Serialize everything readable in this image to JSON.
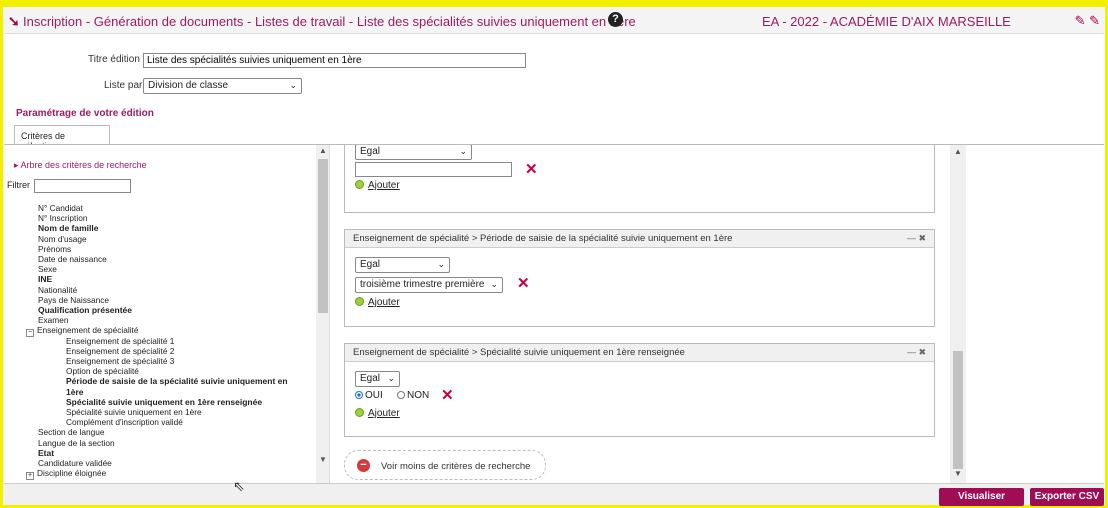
{
  "header": {
    "title": "Inscription - Génération de documents - Listes de travail - Liste des spécialités suivies uniquement en 1ère",
    "exam": "EA - 2022 - ACADÉMIE D'AIX MARSEILLE"
  },
  "form": {
    "titre_label": "Titre édition",
    "titre_value": "Liste des spécialités suivies uniquement en 1ère",
    "liste_par_label": "Liste par",
    "liste_par_value": "Division de classe",
    "required_mark": "*"
  },
  "section_title": "Paramétrage de votre édition",
  "tab_label": "Critères de sélection",
  "tree": {
    "heading": "Arbre des critères de recherche",
    "filter_label": "Filtrer",
    "items": [
      {
        "label": "N° Candidat",
        "bold": false,
        "indent": 0
      },
      {
        "label": "N° Inscription",
        "bold": false,
        "indent": 0
      },
      {
        "label": "Nom de famille",
        "bold": true,
        "indent": 0
      },
      {
        "label": "Nom d'usage",
        "bold": false,
        "indent": 0
      },
      {
        "label": "Prénoms",
        "bold": false,
        "indent": 0
      },
      {
        "label": "Date de naissance",
        "bold": false,
        "indent": 0
      },
      {
        "label": "Sexe",
        "bold": false,
        "indent": 0
      },
      {
        "label": "INE",
        "bold": true,
        "indent": 0
      },
      {
        "label": "Nationalité",
        "bold": false,
        "indent": 0
      },
      {
        "label": "Pays de Naissance",
        "bold": false,
        "indent": 0
      },
      {
        "label": "Qualification présentée",
        "bold": true,
        "indent": 0
      },
      {
        "label": "Examen",
        "bold": false,
        "indent": 0
      },
      {
        "label": "Enseignement de spécialité",
        "bold": false,
        "indent": -1,
        "toggle": "−"
      },
      {
        "label": "Enseignement de spécialité 1",
        "bold": false,
        "indent": 1
      },
      {
        "label": "Enseignement de spécialité 2",
        "bold": false,
        "indent": 1
      },
      {
        "label": "Enseignement de spécialité 3",
        "bold": false,
        "indent": 1
      },
      {
        "label": "Option de spécialité",
        "bold": false,
        "indent": 1
      },
      {
        "label": "Période de saisie de la spécialité suivie uniquement en",
        "bold": true,
        "indent": 1
      },
      {
        "label": "1ère",
        "bold": true,
        "indent": 1
      },
      {
        "label": "Spécialité suivie uniquement en 1ère renseignée",
        "bold": true,
        "indent": 1
      },
      {
        "label": "Spécialité suivie uniquement en 1ère",
        "bold": false,
        "indent": 1
      },
      {
        "label": "Complément d'inscription validé",
        "bold": false,
        "indent": 1
      },
      {
        "label": "Section de langue",
        "bold": false,
        "indent": 0
      },
      {
        "label": "Langue de la section",
        "bold": false,
        "indent": 0
      },
      {
        "label": "Etat",
        "bold": true,
        "indent": 0
      },
      {
        "label": "Candidature validée",
        "bold": false,
        "indent": 0
      },
      {
        "label": "Discipline éloignée",
        "bold": false,
        "indent": -1,
        "toggle": "+"
      }
    ]
  },
  "panel_top": {
    "operator": "Egal",
    "add_label": "Ajouter"
  },
  "panel_periode": {
    "title": "Enseignement de spécialité > Période de saisie de la spécialité suivie uniquement en 1ère",
    "operator": "Egal",
    "value": "troisième trimestre première",
    "add_label": "Ajouter",
    "controls": "— ✖"
  },
  "panel_renseignee": {
    "title": "Enseignement de spécialité > Spécialité suivie uniquement en 1ère renseignée",
    "operator": "Egal",
    "radio_oui": "OUI",
    "radio_non": "NON",
    "add_label": "Ajouter",
    "controls": "— ✖"
  },
  "less_criteria_label": "Voir moins de critères de recherche",
  "buttons": {
    "visualiser": "Visualiser",
    "exporter": "Exporter CSV"
  },
  "colors": {
    "accent": "#a10d55",
    "title": "#9b1b63",
    "delete": "#c4004a"
  }
}
